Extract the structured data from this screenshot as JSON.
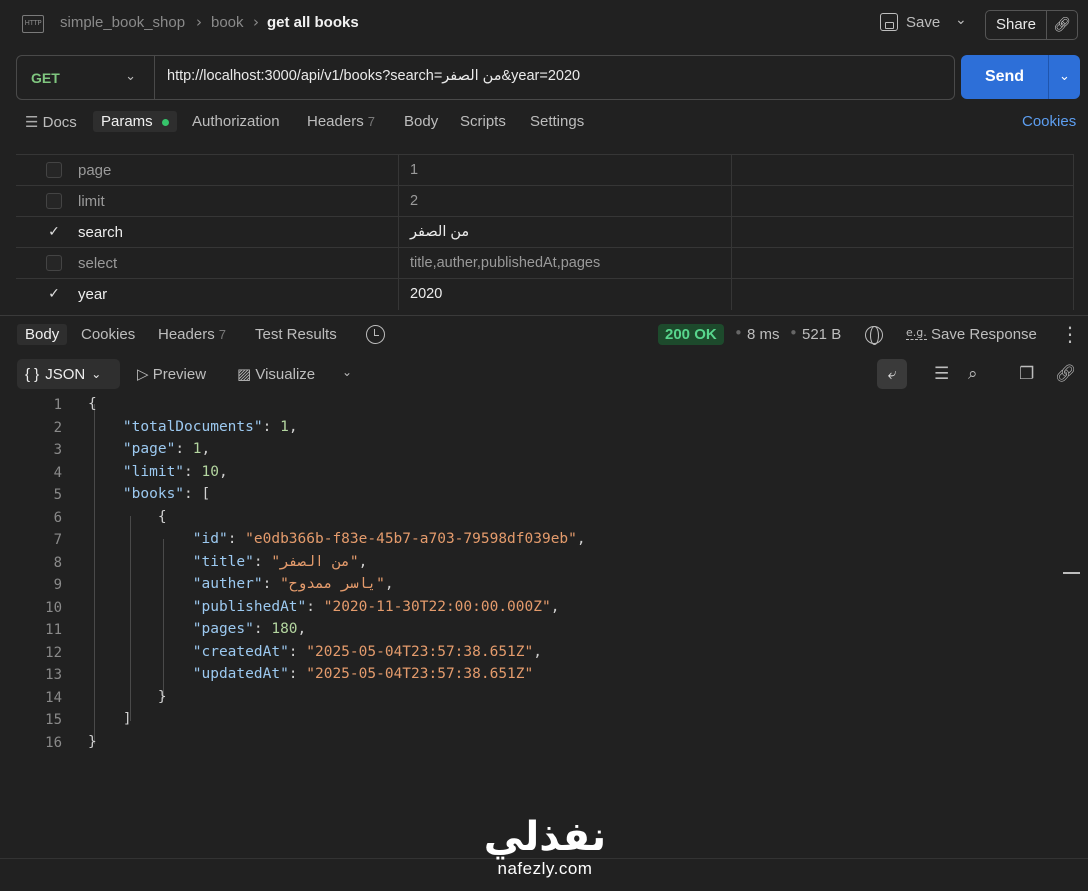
{
  "breadcrumb": {
    "collection": "simple_book_shop",
    "folder": "book",
    "request": "get all books"
  },
  "header": {
    "save_label": "Save",
    "share_label": "Share"
  },
  "request": {
    "method": "GET",
    "url": "http://localhost:3000/api/v1/books?search=من الصفر&year=2020",
    "send_label": "Send"
  },
  "request_tabs": {
    "docs": "Docs",
    "params": "Params",
    "authorization": "Authorization",
    "headers": "Headers",
    "headers_count": "7",
    "body": "Body",
    "scripts": "Scripts",
    "settings": "Settings",
    "cookies": "Cookies"
  },
  "params": [
    {
      "key": "page",
      "value": "1",
      "checked": false
    },
    {
      "key": "limit",
      "value": "2",
      "checked": false
    },
    {
      "key": "search",
      "value": "من الصفر",
      "checked": true
    },
    {
      "key": "select",
      "value": "title,auther,publishedAt,pages",
      "checked": false
    },
    {
      "key": "year",
      "value": "2020",
      "checked": true
    }
  ],
  "response_tabs": {
    "body": "Body",
    "cookies": "Cookies",
    "headers": "Headers",
    "headers_count": "7",
    "test_results": "Test Results"
  },
  "response_meta": {
    "status": "200 OK",
    "time": "8 ms",
    "size": "521 B",
    "save_response": "Save Response"
  },
  "format_bar": {
    "json": "JSON",
    "preview": "Preview",
    "visualize": "Visualize"
  },
  "code_lines": [
    "1",
    "2",
    "3",
    "4",
    "5",
    "6",
    "7",
    "8",
    "9",
    "10",
    "11",
    "12",
    "13",
    "14",
    "15",
    "16"
  ],
  "response_json": {
    "totalDocuments": "1",
    "page": "1",
    "limit": "10",
    "id": "\"e0db366b-f83e-45b7-a703-79598df039eb\"",
    "title": "\"من الصفر\"",
    "auther": "\"ياسر ممدوح\"",
    "publishedAt": "\"2020-11-30T22:00:00.000Z\"",
    "pages": "180",
    "createdAt": "\"2025-05-04T23:57:38.651Z\"",
    "updatedAt": "\"2025-05-04T23:57:38.651Z\""
  },
  "watermark": {
    "arabic": "نفذلي",
    "domain": "nafezly.com"
  },
  "colors": {
    "accent": "#2d6fd8",
    "method_get": "#7fc67f",
    "status_ok": "#58d68d",
    "link": "#5d9ef0"
  }
}
